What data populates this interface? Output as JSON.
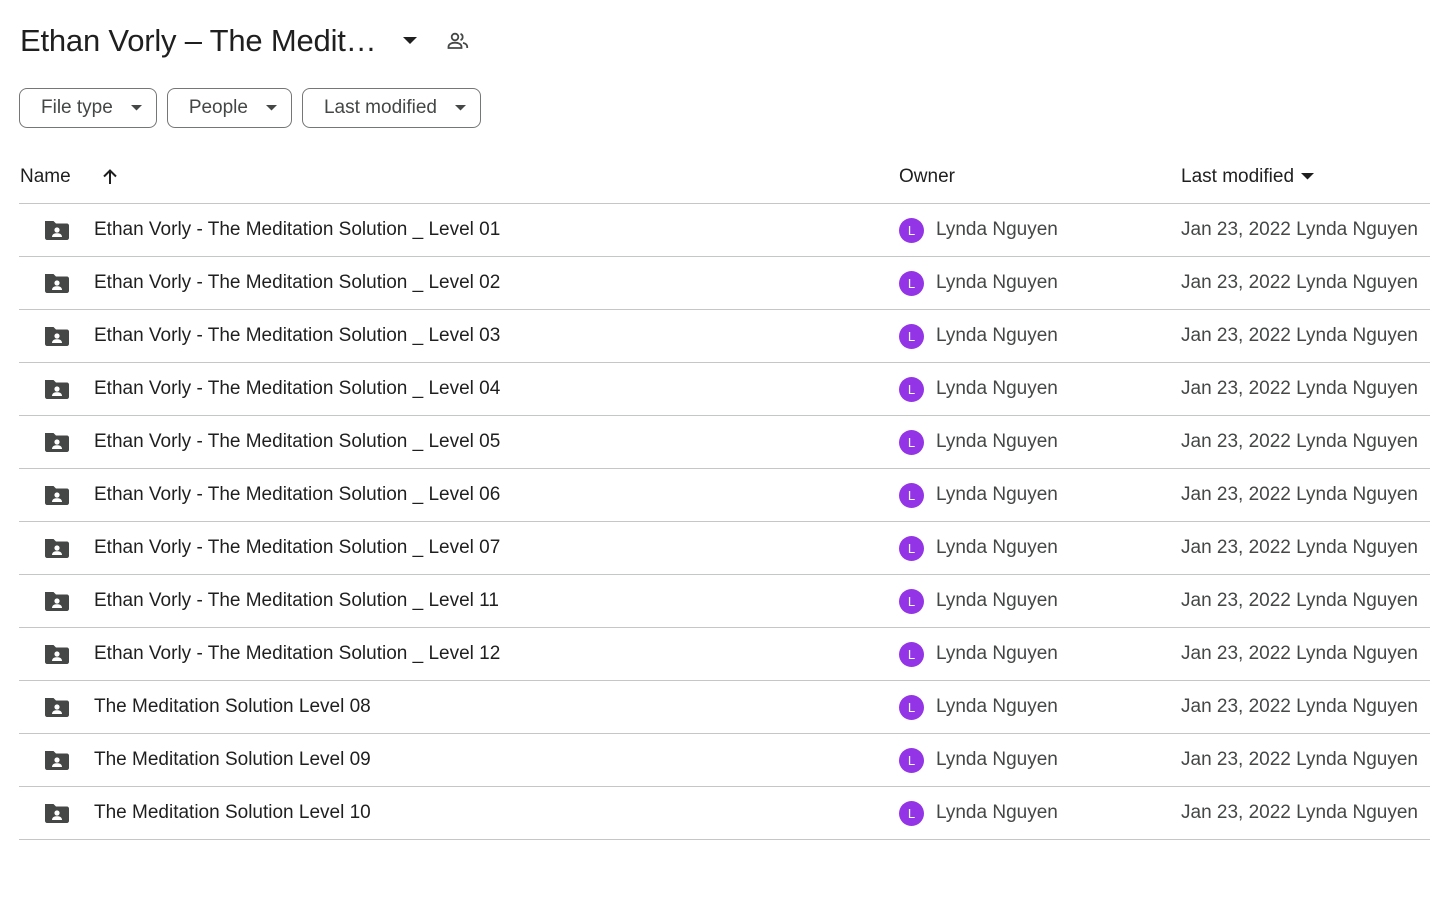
{
  "header": {
    "title": "Ethan Vorly – The Medit…",
    "caret_icon": "arrow-drop-down-icon",
    "shared_icon": "people-icon"
  },
  "filters": [
    {
      "label": "File type"
    },
    {
      "label": "People"
    },
    {
      "label": "Last modified"
    }
  ],
  "columns": {
    "name": "Name",
    "owner": "Owner",
    "last_modified": "Last modified",
    "sort_icon": "arrow-upward-icon"
  },
  "colors": {
    "avatar": "#9334e6",
    "icon": "#444746",
    "border": "#c4c7c5"
  },
  "rows": [
    {
      "name": "Ethan Vorly - The Meditation Solution _ Level 01",
      "owner": "Lynda Nguyen",
      "avatar_letter": "L",
      "modified": "Jan 23, 2022 Lynda Nguyen"
    },
    {
      "name": "Ethan Vorly - The Meditation Solution _ Level 02",
      "owner": "Lynda Nguyen",
      "avatar_letter": "L",
      "modified": "Jan 23, 2022 Lynda Nguyen"
    },
    {
      "name": "Ethan Vorly - The Meditation Solution _ Level 03",
      "owner": "Lynda Nguyen",
      "avatar_letter": "L",
      "modified": "Jan 23, 2022 Lynda Nguyen"
    },
    {
      "name": "Ethan Vorly - The Meditation Solution _ Level 04",
      "owner": "Lynda Nguyen",
      "avatar_letter": "L",
      "modified": "Jan 23, 2022 Lynda Nguyen"
    },
    {
      "name": "Ethan Vorly - The Meditation Solution _ Level 05",
      "owner": "Lynda Nguyen",
      "avatar_letter": "L",
      "modified": "Jan 23, 2022 Lynda Nguyen"
    },
    {
      "name": "Ethan Vorly - The Meditation Solution _ Level 06",
      "owner": "Lynda Nguyen",
      "avatar_letter": "L",
      "modified": "Jan 23, 2022 Lynda Nguyen"
    },
    {
      "name": "Ethan Vorly - The Meditation Solution _ Level 07",
      "owner": "Lynda Nguyen",
      "avatar_letter": "L",
      "modified": "Jan 23, 2022 Lynda Nguyen"
    },
    {
      "name": "Ethan Vorly - The Meditation Solution _ Level 11",
      "owner": "Lynda Nguyen",
      "avatar_letter": "L",
      "modified": "Jan 23, 2022 Lynda Nguyen"
    },
    {
      "name": "Ethan Vorly - The Meditation Solution _ Level 12",
      "owner": "Lynda Nguyen",
      "avatar_letter": "L",
      "modified": "Jan 23, 2022 Lynda Nguyen"
    },
    {
      "name": "The Meditation Solution Level 08",
      "owner": "Lynda Nguyen",
      "avatar_letter": "L",
      "modified": "Jan 23, 2022 Lynda Nguyen"
    },
    {
      "name": "The Meditation Solution Level 09",
      "owner": "Lynda Nguyen",
      "avatar_letter": "L",
      "modified": "Jan 23, 2022 Lynda Nguyen"
    },
    {
      "name": "The Meditation Solution Level 10",
      "owner": "Lynda Nguyen",
      "avatar_letter": "L",
      "modified": "Jan 23, 2022 Lynda Nguyen"
    }
  ]
}
